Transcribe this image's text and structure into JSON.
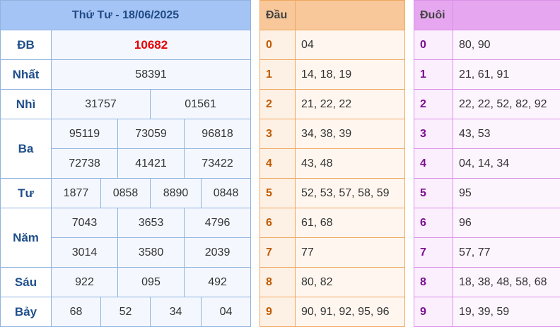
{
  "results": {
    "date_title": "Thứ Tư - 18/06/2025",
    "rows": {
      "db": {
        "label": "ĐB",
        "values": [
          "10682"
        ]
      },
      "nhat": {
        "label": "Nhất",
        "values": [
          "58391"
        ]
      },
      "nhi": {
        "label": "Nhì",
        "values": [
          "31757",
          "01561"
        ]
      },
      "ba": {
        "label": "Ba",
        "values": [
          "95119",
          "73059",
          "96818",
          "72738",
          "41421",
          "73422"
        ]
      },
      "tu": {
        "label": "Tư",
        "values": [
          "1877",
          "0858",
          "8890",
          "0848"
        ]
      },
      "nam": {
        "label": "Năm",
        "values": [
          "7043",
          "3653",
          "4796",
          "3014",
          "3580",
          "2039"
        ]
      },
      "sau": {
        "label": "Sáu",
        "values": [
          "922",
          "095",
          "492"
        ]
      },
      "bay": {
        "label": "Bảy",
        "values": [
          "68",
          "52",
          "34",
          "04"
        ]
      }
    }
  },
  "dau": {
    "header": "Đầu",
    "rows": [
      {
        "key": "0",
        "value": "04"
      },
      {
        "key": "1",
        "value": "14, 18, 19"
      },
      {
        "key": "2",
        "value": "21, 22, 22"
      },
      {
        "key": "3",
        "value": "34, 38, 39"
      },
      {
        "key": "4",
        "value": "43, 48"
      },
      {
        "key": "5",
        "value": "52, 53, 57, 58, 59"
      },
      {
        "key": "6",
        "value": "61, 68"
      },
      {
        "key": "7",
        "value": "77"
      },
      {
        "key": "8",
        "value": "80, 82"
      },
      {
        "key": "9",
        "value": "90, 91, 92, 95, 96"
      }
    ]
  },
  "duoi": {
    "header": "Đuôi",
    "rows": [
      {
        "key": "0",
        "value": "80, 90"
      },
      {
        "key": "1",
        "value": "21, 61, 91"
      },
      {
        "key": "2",
        "value": "22, 22, 52, 82, 92"
      },
      {
        "key": "3",
        "value": "43, 53"
      },
      {
        "key": "4",
        "value": "04, 14, 34"
      },
      {
        "key": "5",
        "value": "95"
      },
      {
        "key": "6",
        "value": "96"
      },
      {
        "key": "7",
        "value": "57, 77"
      },
      {
        "key": "8",
        "value": "18, 38, 48, 58, 68"
      },
      {
        "key": "9",
        "value": "19, 39, 59"
      }
    ]
  },
  "colors": {
    "special_prize": "#e60000",
    "results_header": "#a3c4f5",
    "dau_header": "#f8c89a",
    "duoi_header": "#e6a6f0"
  }
}
